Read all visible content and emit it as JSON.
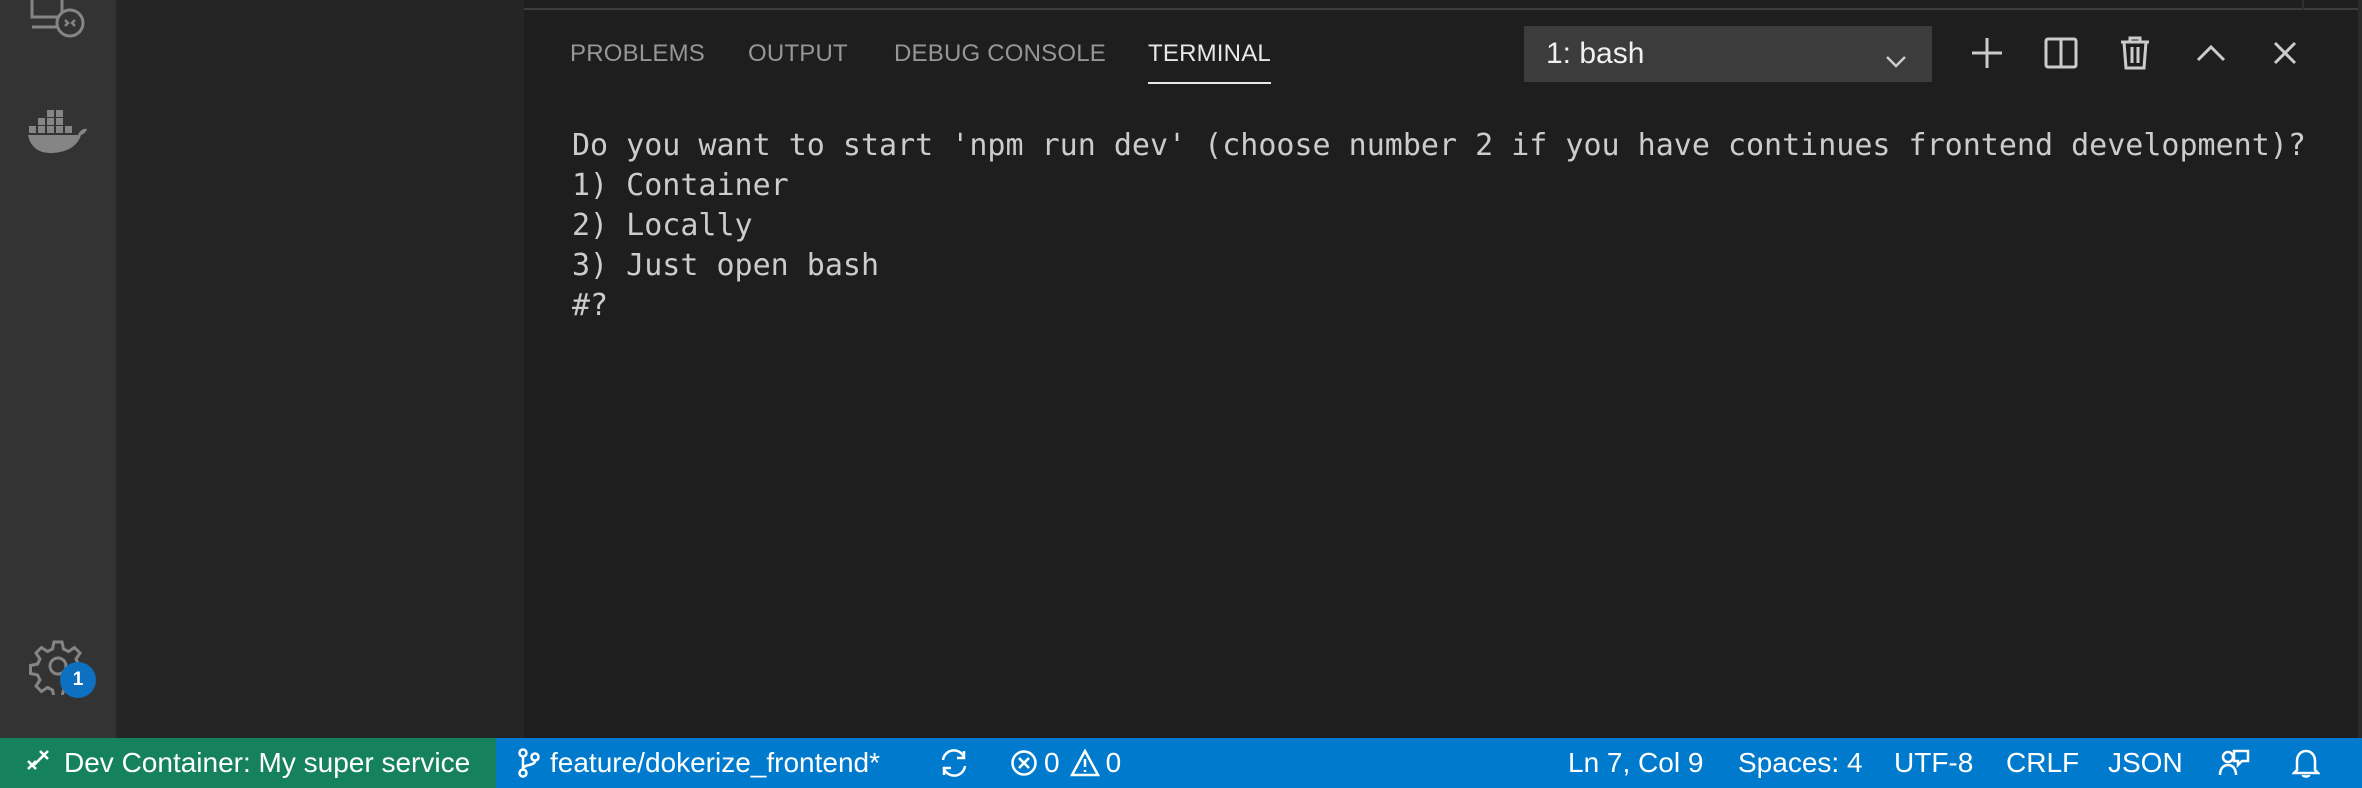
{
  "panel": {
    "tabs": [
      {
        "label": "PROBLEMS"
      },
      {
        "label": "OUTPUT"
      },
      {
        "label": "DEBUG CONSOLE"
      },
      {
        "label": "TERMINAL",
        "active": true
      }
    ],
    "terminal_select": {
      "value": "1: bash"
    },
    "actions": [
      "plus-icon",
      "split-terminal-icon",
      "trash-icon",
      "maximize-panel-icon",
      "close-icon"
    ]
  },
  "terminal": {
    "lines": [
      "Do you want to start 'npm run dev' (choose number 2 if you have continues frontend development)?",
      "1) Container",
      "2) Locally",
      "3) Just open bash",
      "#?"
    ]
  },
  "activity_bar": {
    "items": [
      "remote-explorer-icon",
      "docker-icon"
    ],
    "manage": {
      "icon": "gear-icon",
      "badge": "1"
    }
  },
  "status_bar": {
    "remote": "Dev Container: My super service",
    "branch": "feature/dokerize_frontend*",
    "errors": "0",
    "warnings": "0",
    "position": "Ln 7, Col 9",
    "spaces": "Spaces: 4",
    "encoding": "UTF-8",
    "eol": "CRLF",
    "language": "JSON"
  },
  "colors": {
    "status_bar": "#007acc",
    "remote_indicator": "#16825d",
    "badge": "#0e70c0",
    "panel_bg": "#1e1e1e",
    "sidebar_bg": "#252526",
    "activity_bar_bg": "#333333"
  }
}
